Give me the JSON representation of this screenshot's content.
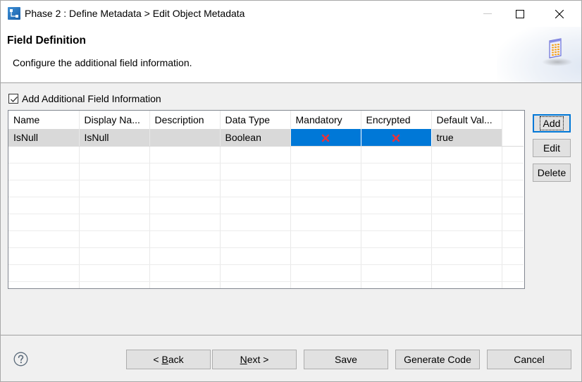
{
  "window": {
    "title": "Phase 2 : Define Metadata > Edit Object Metadata",
    "icon": "wizard-app-icon",
    "controls": [
      "minimize",
      "maximize",
      "close"
    ]
  },
  "banner": {
    "title": "Field Definition",
    "description": "Configure the additional field information.",
    "icon": "table-spreadsheet-icon"
  },
  "options": {
    "add_field_info_label": "Add Additional Field Information",
    "add_field_info_checked": true
  },
  "table": {
    "columns": [
      "Name",
      "Display Na...",
      "Description",
      "Data Type",
      "Mandatory",
      "Encrypted",
      "Default Val..."
    ],
    "rows": [
      {
        "name": "IsNull",
        "display_name": "IsNull",
        "description": "",
        "data_type": "Boolean",
        "mandatory": false,
        "encrypted": false,
        "default_value": "true",
        "selected": true
      }
    ],
    "empty_rows": 9
  },
  "side_buttons": {
    "add": "Add",
    "edit": "Edit",
    "delete": "Delete"
  },
  "footer": {
    "help_icon": "help-icon",
    "back_prefix": "< ",
    "back_mnemonic": "B",
    "back_rest": "ack",
    "next_mnemonic": "N",
    "next_rest": "ext >",
    "save": "Save",
    "generate_code": "Generate Code",
    "cancel": "Cancel"
  },
  "colors": {
    "selection_blue": "#0078d7",
    "row_selected_gray": "#d9d9d9",
    "button_face": "#e1e1e1",
    "dialog_bg": "#f0f0f0",
    "false_mark_red": "#e8323c"
  }
}
